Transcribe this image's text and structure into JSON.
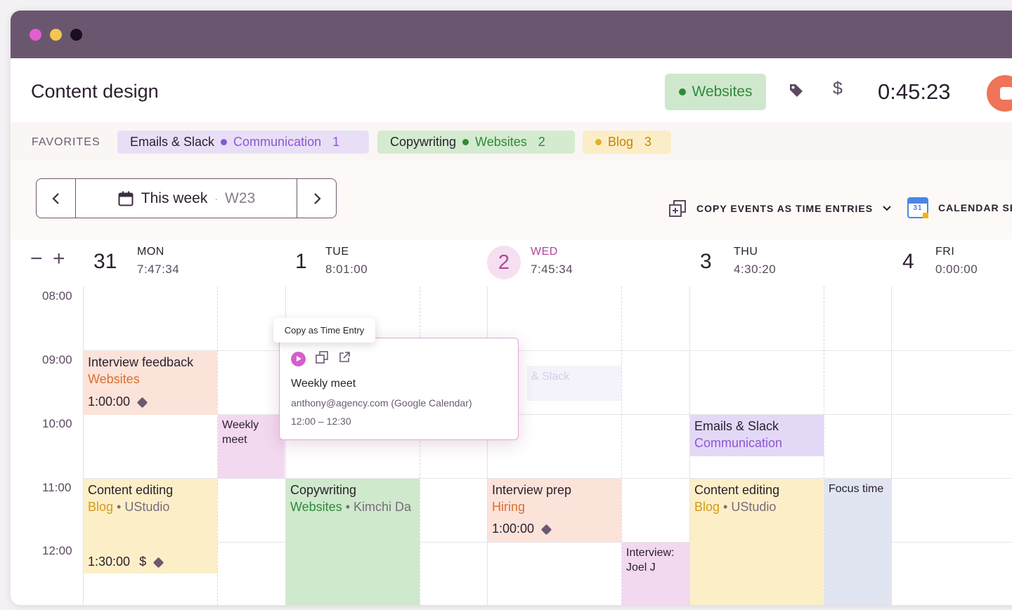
{
  "header": {
    "title": "Content design",
    "project": "Websites",
    "timer": "0:45:23",
    "colors": {
      "accent": "#b0459c",
      "titlebar": "#6b5670",
      "stop": "#ef7458"
    }
  },
  "favorites": {
    "label": "FAVORITES",
    "items": [
      {
        "task": "Emails & Slack",
        "project": "Communication",
        "count": "1"
      },
      {
        "task": "Copywriting",
        "project": "Websites",
        "count": "2"
      },
      {
        "task": "",
        "project": "Blog",
        "count": "3"
      }
    ]
  },
  "toolbar": {
    "week_label": "This week",
    "week_sep": "·",
    "week_code": "W23",
    "copy_events": "COPY EVENTS AS TIME ENTRIES",
    "calendar_settings": "CALENDAR SE",
    "calendar_icon_num": "31"
  },
  "days": [
    {
      "num": "31",
      "name": "MON",
      "total": "7:47:34"
    },
    {
      "num": "1",
      "name": "TUE",
      "total": "8:01:00"
    },
    {
      "num": "2",
      "name": "WED",
      "total": "7:45:34"
    },
    {
      "num": "3",
      "name": "THU",
      "total": "4:30:20"
    },
    {
      "num": "4",
      "name": "FRI",
      "total": "0:00:00"
    }
  ],
  "hours": [
    "08:00",
    "09:00",
    "10:00",
    "11:00",
    "12:00"
  ],
  "events": {
    "mon_interview": {
      "title": "Interview feedback",
      "project": "Websites",
      "duration": "1:00:00"
    },
    "mon_weekly": {
      "title": "Weekly meet"
    },
    "mon_content": {
      "title": "Content editing",
      "project": "Blog",
      "client": "UStudio",
      "duration": "1:30:00"
    },
    "tue_copy": {
      "title": "Copywriting",
      "project": "Websites",
      "client": "Kimchi Da"
    },
    "wed_ghost": {
      "title": "& Slack"
    },
    "wed_interview": {
      "title": "Interview prep",
      "project": "Hiring",
      "duration": "1:00:00"
    },
    "wed_joel": {
      "title": "Interview: Joel J"
    },
    "thu_emails": {
      "title": "Emails & Slack",
      "project": "Communication"
    },
    "thu_content": {
      "title": "Content editing",
      "project": "Blog",
      "client": "UStudio"
    },
    "thu_focus": {
      "title": "Focus time"
    }
  },
  "tooltip": "Copy as Time Entry",
  "popover": {
    "title": "Weekly meet",
    "calendar": "anthony@agency.com (Google Calendar)",
    "time": "12:00 – 12:30"
  }
}
